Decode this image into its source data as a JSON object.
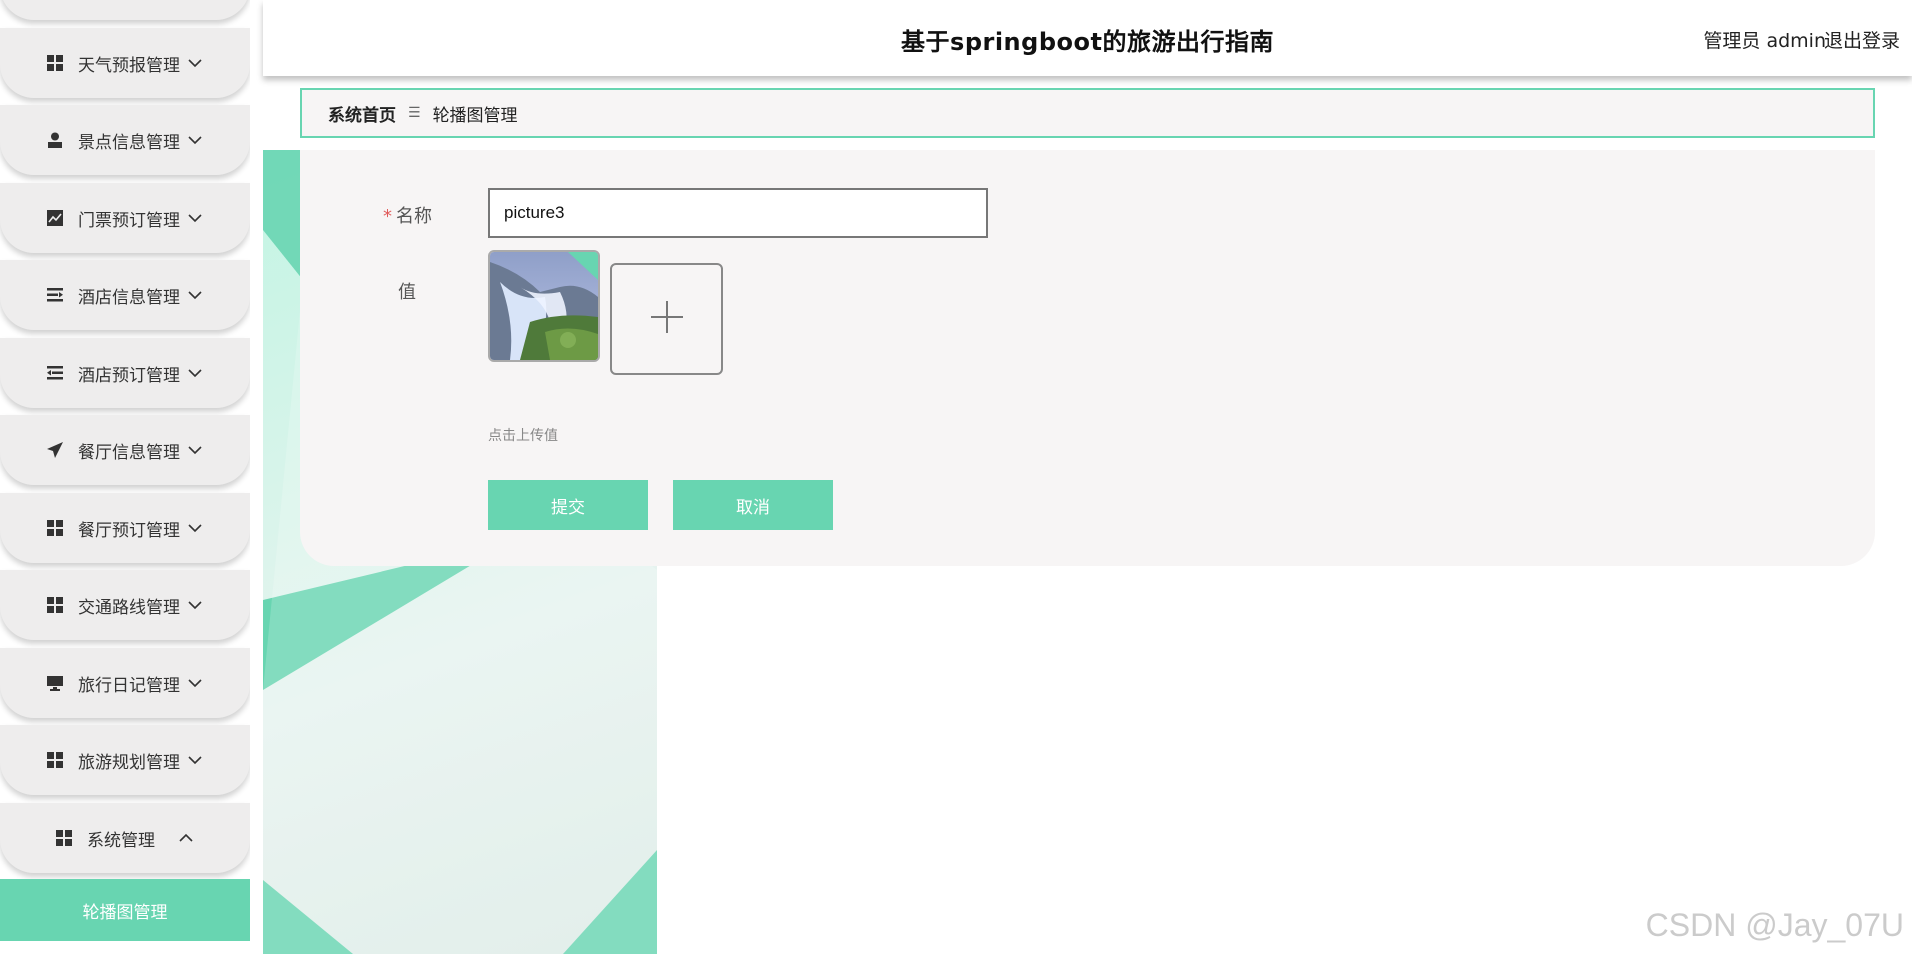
{
  "header": {
    "title": "基于springboot的旅游出行指南",
    "user": "管理员 admin",
    "logout": "退出登录"
  },
  "sidebar": {
    "items": [
      {
        "label": "天气预报管理",
        "icon": "grid-icon"
      },
      {
        "label": "景点信息管理",
        "icon": "person-icon"
      },
      {
        "label": "门票预订管理",
        "icon": "chart-icon"
      },
      {
        "label": "酒店信息管理",
        "icon": "list-indent-icon"
      },
      {
        "label": "酒店预订管理",
        "icon": "list-outdent-icon"
      },
      {
        "label": "餐厅信息管理",
        "icon": "paper-plane-icon"
      },
      {
        "label": "餐厅预订管理",
        "icon": "grid-icon"
      },
      {
        "label": "交通路线管理",
        "icon": "grid-icon"
      },
      {
        "label": "旅行日记管理",
        "icon": "monitor-icon"
      },
      {
        "label": "旅游规划管理",
        "icon": "grid-icon"
      },
      {
        "label": "系统管理",
        "icon": "grid-icon",
        "expanded": true
      }
    ],
    "active_sub": "轮播图管理",
    "accent": "#68d5b1"
  },
  "breadcrumb": {
    "home": "系统首页",
    "sep": "☰",
    "current": "轮播图管理"
  },
  "form": {
    "name_label": "名称",
    "name_value": "picture3",
    "value_label": "值",
    "upload_tip": "点击上传值",
    "submit": "提交",
    "cancel": "取消"
  },
  "watermark": "CSDN @Jay_07U"
}
